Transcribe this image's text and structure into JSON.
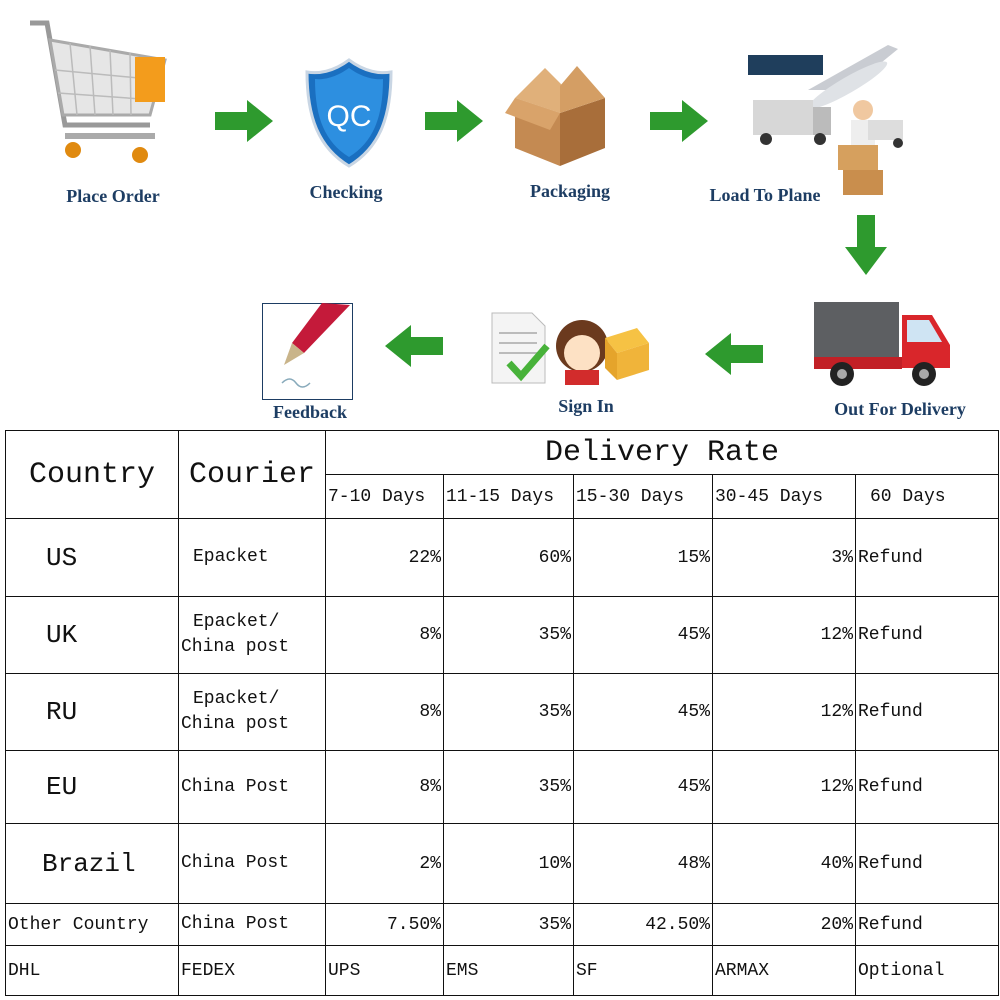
{
  "process": {
    "steps": [
      {
        "label": "Place Order",
        "icon": "shopping-cart-icon"
      },
      {
        "label": "Checking",
        "icon": "qc-shield-icon"
      },
      {
        "label": "Packaging",
        "icon": "cardboard-box-icon"
      },
      {
        "label": "Load To Plane",
        "icon": "plane-truck-icon"
      },
      {
        "label": "Out For Delivery",
        "icon": "delivery-truck-icon"
      },
      {
        "label": "Sign In",
        "icon": "sign-in-icon"
      },
      {
        "label": "Feedback",
        "icon": "pen-icon"
      }
    ],
    "arrow_color": "#2e9a2e",
    "qc_text": "QC"
  },
  "table": {
    "headers": {
      "country": "Country",
      "courier": "Courier",
      "delivery_rate": "Delivery Rate"
    },
    "periods": [
      "7-10 Days",
      "11-15 Days",
      "15-30 Days",
      "30-45 Days",
      "60 Days"
    ],
    "rows": [
      {
        "country": "US",
        "courier": [
          "Epacket"
        ],
        "rates": [
          "22%",
          "60%",
          "15%",
          "3%",
          "Refund"
        ]
      },
      {
        "country": "UK",
        "courier": [
          "Epacket/",
          "China post"
        ],
        "rates": [
          "8%",
          "35%",
          "45%",
          "12%",
          "Refund"
        ]
      },
      {
        "country": "RU",
        "courier": [
          "Epacket/",
          "China post"
        ],
        "rates": [
          "8%",
          "35%",
          "45%",
          "12%",
          "Refund"
        ]
      },
      {
        "country": "EU",
        "courier": [
          "China Post"
        ],
        "rates": [
          "8%",
          "35%",
          "45%",
          "12%",
          "Refund"
        ]
      },
      {
        "country": "Brazil",
        "courier": [
          "China Post"
        ],
        "rates": [
          "2%",
          "10%",
          "48%",
          "40%",
          "Refund"
        ]
      },
      {
        "country": "Other Country",
        "courier": [
          "China Post"
        ],
        "rates": [
          "7.50%",
          "35%",
          "42.50%",
          "20%",
          "Refund"
        ]
      }
    ],
    "couriers_row": [
      "DHL",
      "FEDEX",
      "UPS",
      "EMS",
      "SF",
      "ARMAX",
      "Optional"
    ]
  }
}
